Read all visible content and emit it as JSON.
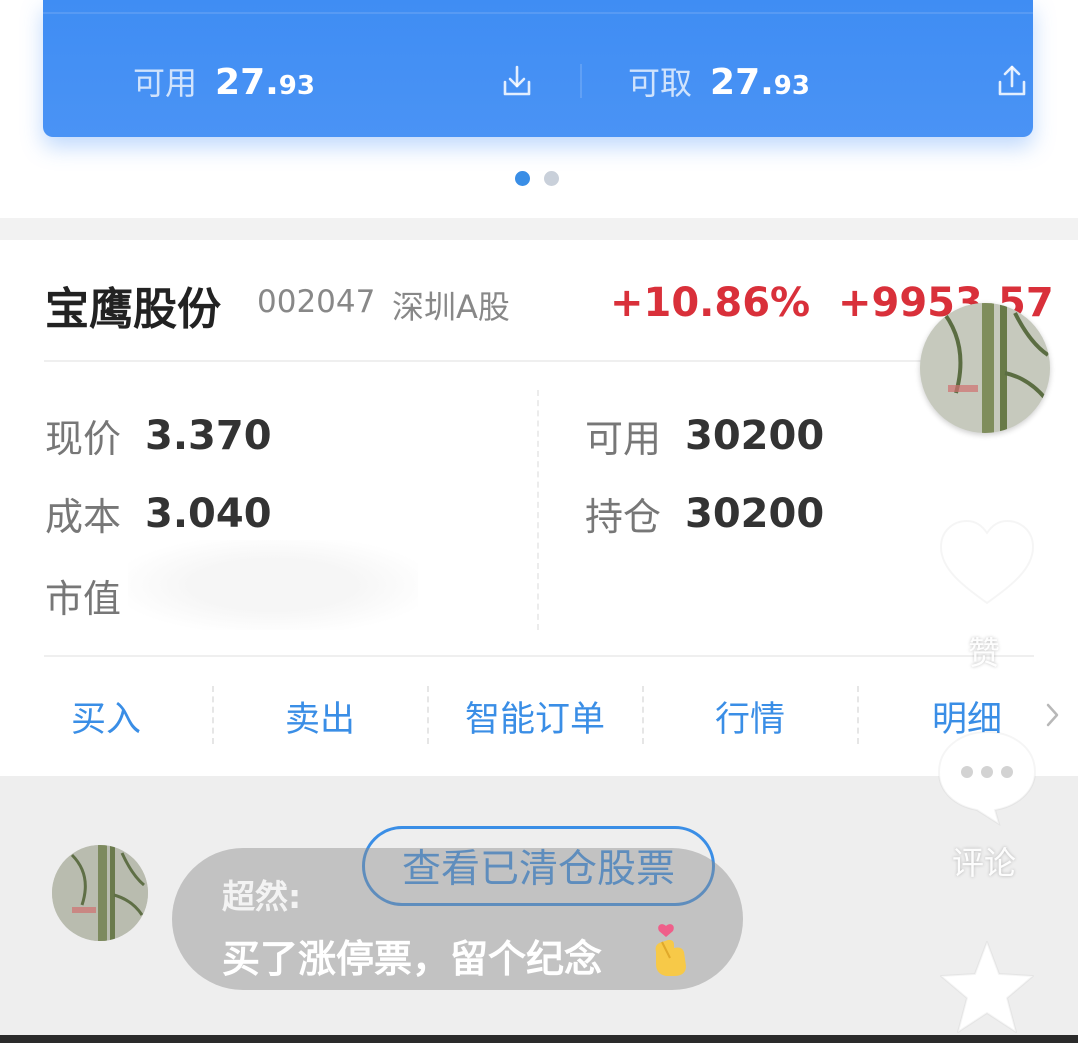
{
  "account_card": {
    "available_label": "可用",
    "available_int": "27.",
    "available_dec": "93",
    "withdrawable_label": "可取",
    "withdrawable_int": "27.",
    "withdrawable_dec": "93",
    "download_icon": "download-tray-icon",
    "upload_icon": "upload-tray-icon",
    "page_indicator": {
      "count": 2,
      "active_index": 0
    }
  },
  "holding": {
    "name": "宝鹰股份",
    "code": "002047",
    "market": "深圳A股",
    "change_pct": "+10.86%",
    "profit": "+9953.57",
    "price_label": "现价",
    "price_value": "3.370",
    "cost_label": "成本",
    "cost_value": "3.040",
    "market_value_label": "市值",
    "available_label": "可用",
    "available_value": "30200",
    "position_label": "持仓",
    "position_value": "30200"
  },
  "actions": {
    "buy": "买入",
    "sell": "卖出",
    "smart_order": "智能订单",
    "quote": "行情",
    "detail": "明细"
  },
  "cleared_button": "查看已清仓股票",
  "comment": {
    "user": "超然:",
    "text": "买了涨停票，留个纪念"
  },
  "side_actions": {
    "like_label": "赞",
    "comment_label": "评论"
  },
  "colors": {
    "accent_blue": "#3a8ee6",
    "card_blue": "#4a93f5",
    "up_red": "#d9303a"
  }
}
